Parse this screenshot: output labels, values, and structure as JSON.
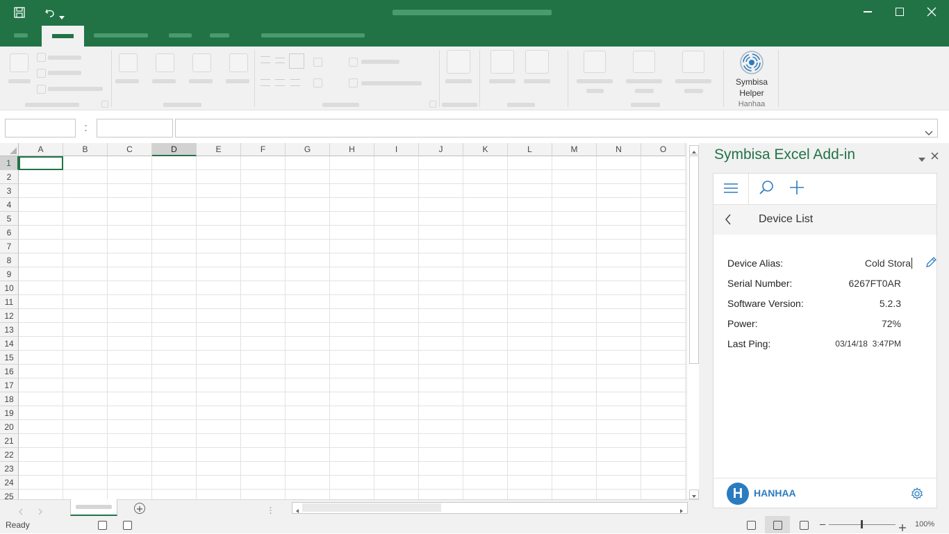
{
  "ribbon": {
    "addin_button": {
      "line1": "Symbisa",
      "line2": "Helper",
      "group_label": "Hanhaa"
    }
  },
  "grid": {
    "columns": [
      "A",
      "B",
      "C",
      "D",
      "E",
      "F",
      "G",
      "H",
      "I",
      "J",
      "K",
      "L",
      "M",
      "N",
      "O"
    ],
    "rows": [
      "1",
      "2",
      "3",
      "4",
      "5",
      "6",
      "7",
      "8",
      "9",
      "10",
      "11",
      "12",
      "13",
      "14",
      "15",
      "16",
      "17",
      "18",
      "19",
      "20",
      "21",
      "22",
      "23",
      "24",
      "25"
    ],
    "selected_column": "D",
    "selected_row": "1"
  },
  "status": {
    "text": "Ready",
    "zoom": "100%"
  },
  "taskpane": {
    "title": "Symbisa Excel Add-in",
    "nav_title": "Device List",
    "fields": [
      {
        "label": "Device Alias:",
        "value": "Cold Stora"
      },
      {
        "label": "Serial Number:",
        "value": "6267FT0AR"
      },
      {
        "label": "Software Version:",
        "value": "5.2.3"
      },
      {
        "label": "Power:",
        "value": "72%"
      },
      {
        "label": "Last Ping:",
        "value": "03/14/18  3:47PM"
      }
    ],
    "footer_brand": "HANHAA",
    "logo_letter": "H"
  },
  "colors": {
    "excel_green": "#217346",
    "accent_blue": "#2b7bc0"
  },
  "icons": [
    "save-icon",
    "undo-icon",
    "minimize-icon",
    "maximize-icon",
    "close-icon",
    "menu-icon",
    "search-icon",
    "plus-icon",
    "back-icon",
    "edit-icon",
    "gear-icon",
    "wifi-broadcast-icon"
  ]
}
